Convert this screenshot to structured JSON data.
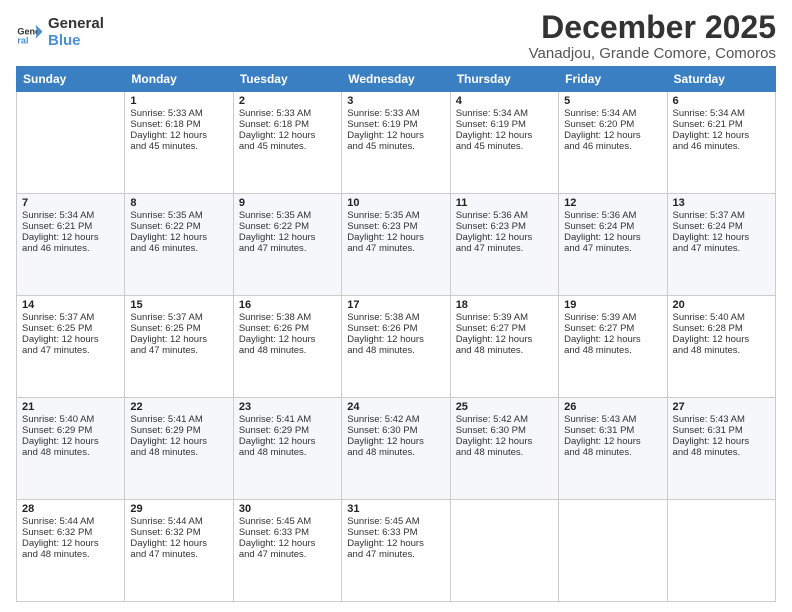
{
  "logo": {
    "general": "General",
    "blue": "Blue"
  },
  "title": "December 2025",
  "subtitle": "Vanadjou, Grande Comore, Comoros",
  "days": [
    "Sunday",
    "Monday",
    "Tuesday",
    "Wednesday",
    "Thursday",
    "Friday",
    "Saturday"
  ],
  "weeks": [
    [
      {
        "num": "",
        "lines": []
      },
      {
        "num": "1",
        "lines": [
          "Sunrise: 5:33 AM",
          "Sunset: 6:18 PM",
          "Daylight: 12 hours",
          "and 45 minutes."
        ]
      },
      {
        "num": "2",
        "lines": [
          "Sunrise: 5:33 AM",
          "Sunset: 6:18 PM",
          "Daylight: 12 hours",
          "and 45 minutes."
        ]
      },
      {
        "num": "3",
        "lines": [
          "Sunrise: 5:33 AM",
          "Sunset: 6:19 PM",
          "Daylight: 12 hours",
          "and 45 minutes."
        ]
      },
      {
        "num": "4",
        "lines": [
          "Sunrise: 5:34 AM",
          "Sunset: 6:19 PM",
          "Daylight: 12 hours",
          "and 45 minutes."
        ]
      },
      {
        "num": "5",
        "lines": [
          "Sunrise: 5:34 AM",
          "Sunset: 6:20 PM",
          "Daylight: 12 hours",
          "and 46 minutes."
        ]
      },
      {
        "num": "6",
        "lines": [
          "Sunrise: 5:34 AM",
          "Sunset: 6:21 PM",
          "Daylight: 12 hours",
          "and 46 minutes."
        ]
      }
    ],
    [
      {
        "num": "7",
        "lines": [
          "Sunrise: 5:34 AM",
          "Sunset: 6:21 PM",
          "Daylight: 12 hours",
          "and 46 minutes."
        ]
      },
      {
        "num": "8",
        "lines": [
          "Sunrise: 5:35 AM",
          "Sunset: 6:22 PM",
          "Daylight: 12 hours",
          "and 46 minutes."
        ]
      },
      {
        "num": "9",
        "lines": [
          "Sunrise: 5:35 AM",
          "Sunset: 6:22 PM",
          "Daylight: 12 hours",
          "and 47 minutes."
        ]
      },
      {
        "num": "10",
        "lines": [
          "Sunrise: 5:35 AM",
          "Sunset: 6:23 PM",
          "Daylight: 12 hours",
          "and 47 minutes."
        ]
      },
      {
        "num": "11",
        "lines": [
          "Sunrise: 5:36 AM",
          "Sunset: 6:23 PM",
          "Daylight: 12 hours",
          "and 47 minutes."
        ]
      },
      {
        "num": "12",
        "lines": [
          "Sunrise: 5:36 AM",
          "Sunset: 6:24 PM",
          "Daylight: 12 hours",
          "and 47 minutes."
        ]
      },
      {
        "num": "13",
        "lines": [
          "Sunrise: 5:37 AM",
          "Sunset: 6:24 PM",
          "Daylight: 12 hours",
          "and 47 minutes."
        ]
      }
    ],
    [
      {
        "num": "14",
        "lines": [
          "Sunrise: 5:37 AM",
          "Sunset: 6:25 PM",
          "Daylight: 12 hours",
          "and 47 minutes."
        ]
      },
      {
        "num": "15",
        "lines": [
          "Sunrise: 5:37 AM",
          "Sunset: 6:25 PM",
          "Daylight: 12 hours",
          "and 47 minutes."
        ]
      },
      {
        "num": "16",
        "lines": [
          "Sunrise: 5:38 AM",
          "Sunset: 6:26 PM",
          "Daylight: 12 hours",
          "and 48 minutes."
        ]
      },
      {
        "num": "17",
        "lines": [
          "Sunrise: 5:38 AM",
          "Sunset: 6:26 PM",
          "Daylight: 12 hours",
          "and 48 minutes."
        ]
      },
      {
        "num": "18",
        "lines": [
          "Sunrise: 5:39 AM",
          "Sunset: 6:27 PM",
          "Daylight: 12 hours",
          "and 48 minutes."
        ]
      },
      {
        "num": "19",
        "lines": [
          "Sunrise: 5:39 AM",
          "Sunset: 6:27 PM",
          "Daylight: 12 hours",
          "and 48 minutes."
        ]
      },
      {
        "num": "20",
        "lines": [
          "Sunrise: 5:40 AM",
          "Sunset: 6:28 PM",
          "Daylight: 12 hours",
          "and 48 minutes."
        ]
      }
    ],
    [
      {
        "num": "21",
        "lines": [
          "Sunrise: 5:40 AM",
          "Sunset: 6:29 PM",
          "Daylight: 12 hours",
          "and 48 minutes."
        ]
      },
      {
        "num": "22",
        "lines": [
          "Sunrise: 5:41 AM",
          "Sunset: 6:29 PM",
          "Daylight: 12 hours",
          "and 48 minutes."
        ]
      },
      {
        "num": "23",
        "lines": [
          "Sunrise: 5:41 AM",
          "Sunset: 6:29 PM",
          "Daylight: 12 hours",
          "and 48 minutes."
        ]
      },
      {
        "num": "24",
        "lines": [
          "Sunrise: 5:42 AM",
          "Sunset: 6:30 PM",
          "Daylight: 12 hours",
          "and 48 minutes."
        ]
      },
      {
        "num": "25",
        "lines": [
          "Sunrise: 5:42 AM",
          "Sunset: 6:30 PM",
          "Daylight: 12 hours",
          "and 48 minutes."
        ]
      },
      {
        "num": "26",
        "lines": [
          "Sunrise: 5:43 AM",
          "Sunset: 6:31 PM",
          "Daylight: 12 hours",
          "and 48 minutes."
        ]
      },
      {
        "num": "27",
        "lines": [
          "Sunrise: 5:43 AM",
          "Sunset: 6:31 PM",
          "Daylight: 12 hours",
          "and 48 minutes."
        ]
      }
    ],
    [
      {
        "num": "28",
        "lines": [
          "Sunrise: 5:44 AM",
          "Sunset: 6:32 PM",
          "Daylight: 12 hours",
          "and 48 minutes."
        ]
      },
      {
        "num": "29",
        "lines": [
          "Sunrise: 5:44 AM",
          "Sunset: 6:32 PM",
          "Daylight: 12 hours",
          "and 47 minutes."
        ]
      },
      {
        "num": "30",
        "lines": [
          "Sunrise: 5:45 AM",
          "Sunset: 6:33 PM",
          "Daylight: 12 hours",
          "and 47 minutes."
        ]
      },
      {
        "num": "31",
        "lines": [
          "Sunrise: 5:45 AM",
          "Sunset: 6:33 PM",
          "Daylight: 12 hours",
          "and 47 minutes."
        ]
      },
      {
        "num": "",
        "lines": []
      },
      {
        "num": "",
        "lines": []
      },
      {
        "num": "",
        "lines": []
      }
    ]
  ]
}
